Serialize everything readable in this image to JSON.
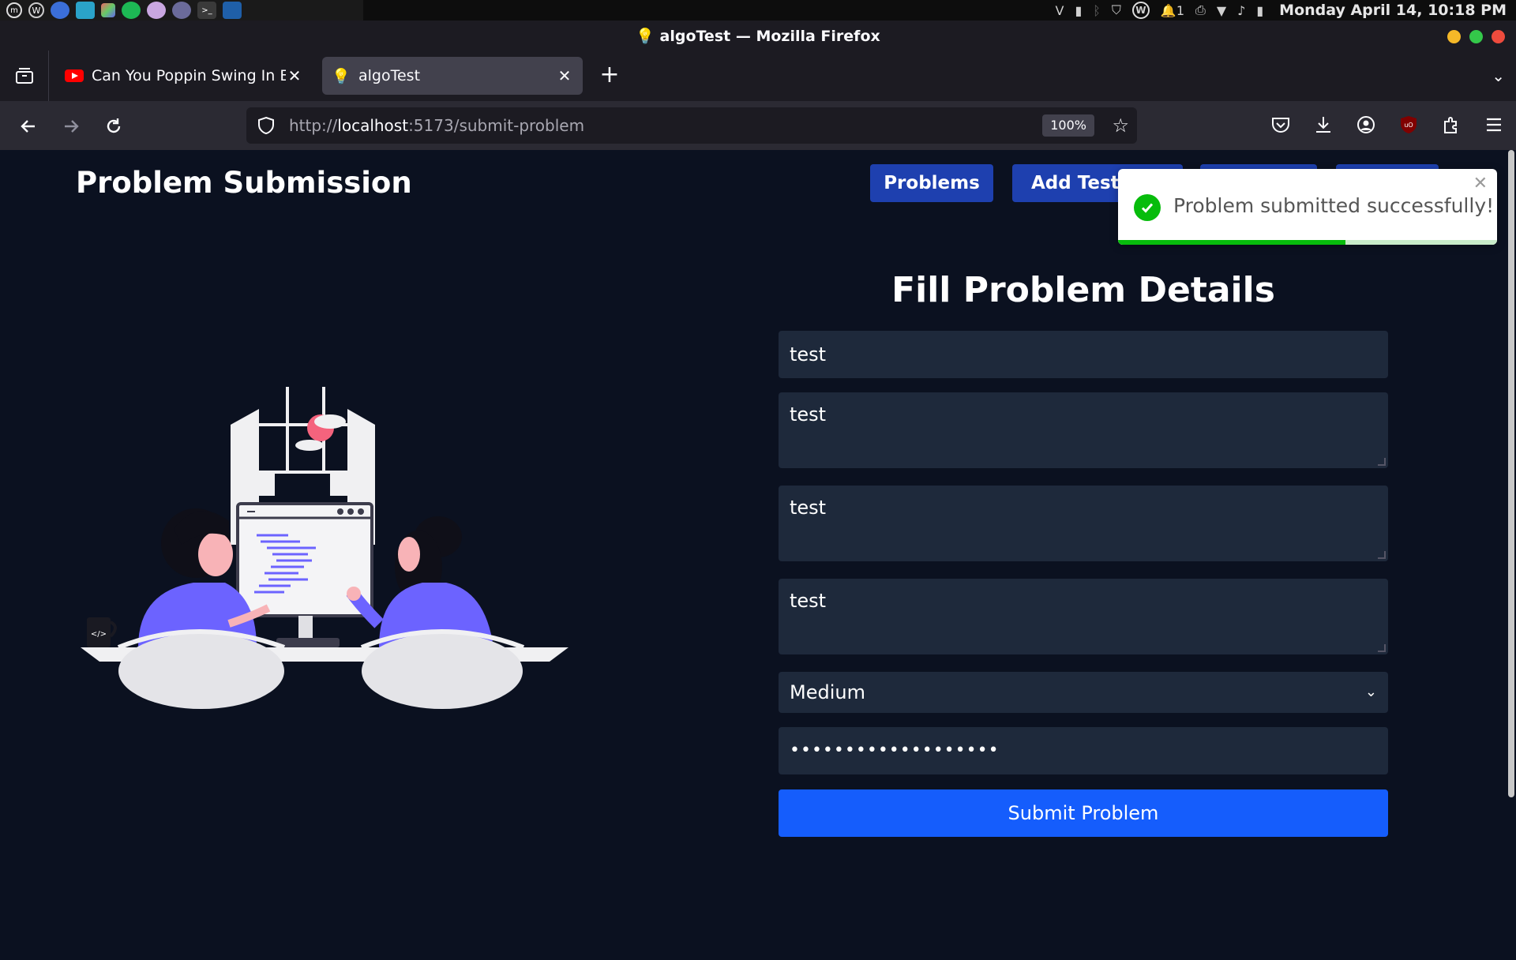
{
  "os": {
    "clock": "Monday April 14, 10:18 PM",
    "notifications_count": "1",
    "launcher_icons": [
      "mint-menu-icon",
      "wordpress-icon",
      "firefox-icon",
      "files-icon",
      "apps-grid-icon",
      "spotify-icon",
      "app-icon",
      "folder-icon",
      "terminal-icon",
      "vscode-icon"
    ],
    "tray_icons": [
      "vpn-icon",
      "clipboard-icon",
      "bluetooth-icon",
      "shield-icon",
      "wordpress-icon",
      "notification-icon",
      "printer-icon",
      "wifi-icon",
      "volume-icon",
      "battery-icon"
    ]
  },
  "browser": {
    "window_title": "💡 algoTest — Mozilla Firefox",
    "tabs": [
      {
        "label": "Can You Poppin Swing In Ev",
        "favicon": "youtube-icon",
        "active": false
      },
      {
        "label": "algoTest",
        "favicon": "lightbulb-icon",
        "active": true
      }
    ],
    "url_scheme": "http://",
    "url_host": "localhost",
    "url_path": ":5173/submit-problem",
    "zoom": "100%",
    "accent": "#155dfc"
  },
  "page": {
    "title": "Problem Submission",
    "nav": [
      {
        "label": "Problems"
      },
      {
        "label": "Add TestC"
      },
      {
        "label": ""
      },
      {
        "label": ""
      }
    ],
    "form": {
      "heading": "Fill Problem Details",
      "title_value": "test",
      "description_value": "test",
      "input_format_value": "test",
      "output_format_value": "test",
      "difficulty_value": "Medium",
      "secret_value": "•••••••••••••••••••",
      "submit_label": "Submit Problem"
    }
  },
  "toast": {
    "message": "Problem submitted successfully!",
    "progress_fraction": 0.6,
    "color": "#07bc0c"
  }
}
